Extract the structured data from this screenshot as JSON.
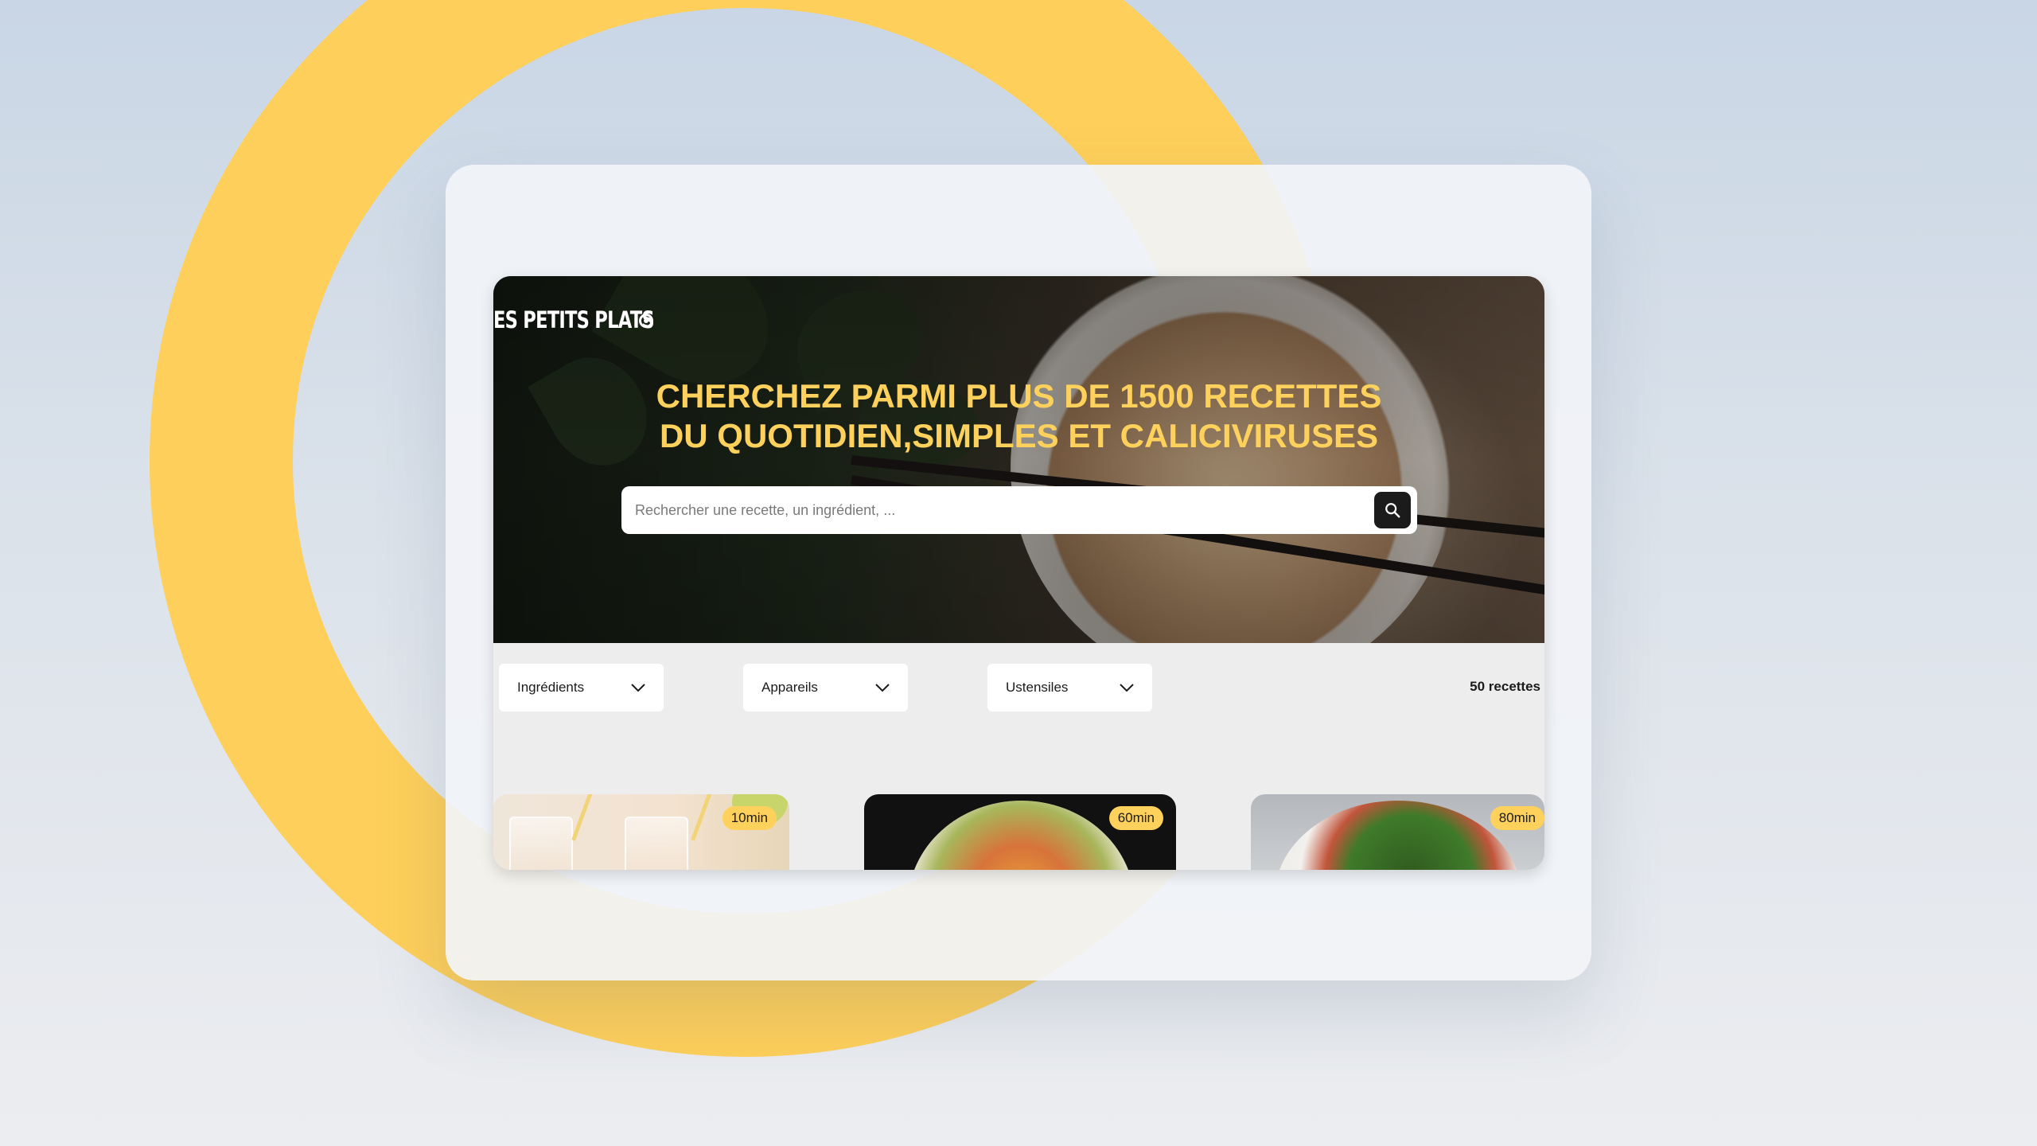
{
  "site": {
    "logo": "ES PETITS PLATS",
    "headline_line1": "CHERCHEZ PARMI PLUS DE 1500 RECETTES",
    "headline_line2": "DU QUOTIDIEN,SIMPLES ET CALICIVIRUSES",
    "search": {
      "placeholder": "Rechercher une recette, un ingrédient, ..."
    }
  },
  "filters": [
    {
      "label": "Ingrédients"
    },
    {
      "label": "Appareils"
    },
    {
      "label": "Ustensiles"
    }
  ],
  "recipe_count": "50 recettes",
  "cards": [
    {
      "time": "10min"
    },
    {
      "time": "60min"
    },
    {
      "time": "80min"
    }
  ],
  "colors": {
    "accent": "#fed15c",
    "dark": "#1b1b1b",
    "page_bg": "#ededed"
  }
}
